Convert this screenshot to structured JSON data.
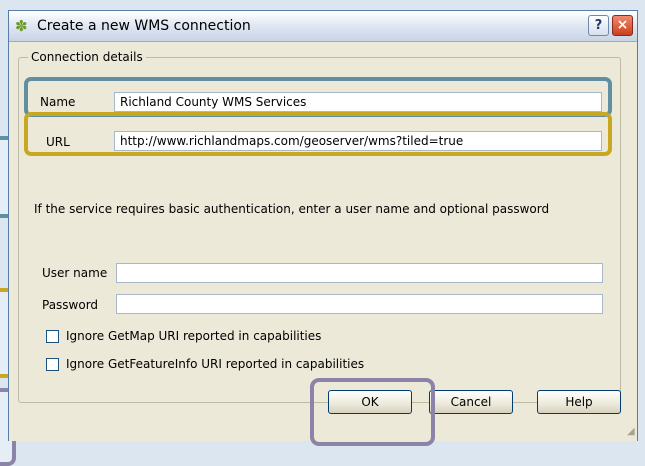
{
  "dialog": {
    "title": "Create a new WMS connection",
    "help_title_label": "?",
    "close_title_label": "×",
    "app_icon": "qgis-icon"
  },
  "connection": {
    "legend": "Connection details",
    "name_label": "Name",
    "name_value": "Richland County WMS Services",
    "url_label": "URL",
    "url_value": "http://www.richlandmaps.com/geoserver/wms?tiled=true"
  },
  "auth": {
    "info": "If the service requires basic authentication, enter a user name and optional password",
    "username_label": "User name",
    "username_value": "",
    "password_label": "Password",
    "password_value": ""
  },
  "options": {
    "ignore_getmap": "Ignore GetMap URI reported in capabilities",
    "ignore_getfeatureinfo": "Ignore GetFeatureInfo URI reported in capabilities"
  },
  "buttons": {
    "ok": "OK",
    "cancel": "Cancel",
    "help": "Help"
  },
  "colors": {
    "highlight_name": "#5f8fa0",
    "highlight_url": "#c8a820",
    "highlight_ok": "#8c84a8"
  }
}
